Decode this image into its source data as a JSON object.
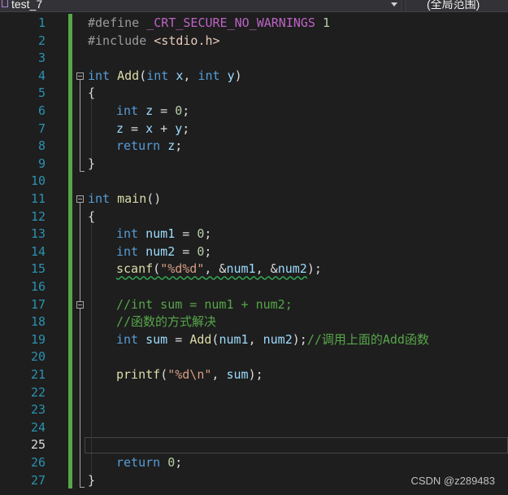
{
  "toolbar": {
    "file_name": "test_7",
    "file_icon": "project-icon",
    "scope_label": "(全局范围)"
  },
  "editor": {
    "current_line": 25,
    "line_numbers": [
      "1",
      "2",
      "3",
      "4",
      "5",
      "6",
      "7",
      "8",
      "9",
      "10",
      "11",
      "12",
      "13",
      "14",
      "15",
      "16",
      "17",
      "18",
      "19",
      "20",
      "21",
      "22",
      "23",
      "24",
      "25",
      "26",
      "27"
    ],
    "code": {
      "l1_define": "#define",
      "l1_macro": "_CRT_SECURE_NO_WARNINGS",
      "l1_value": "1",
      "l2_include": "#include",
      "l2_header": "<stdio.h>",
      "l4_int": "int",
      "l4_name": "Add",
      "l4_open": "(",
      "l4_int2": "int",
      "l4_x": "x",
      "l4_comma": ", ",
      "l4_int3": "int",
      "l4_y": "y",
      "l4_close": ")",
      "l5": "{",
      "l6_int": "int",
      "l6_z": "z",
      "l6_assign": " = ",
      "l6_zero": "0",
      "l6_semi": ";",
      "l7_z": "z",
      "l7_expr_a": " = ",
      "l7_x": "x",
      "l7_plus": " + ",
      "l7_y": "y",
      "l7_semi": ";",
      "l8_return": "return",
      "l8_z": "z",
      "l8_semi": ";",
      "l9": "}",
      "l11_int": "int",
      "l11_main": "main",
      "l11_paren": "()",
      "l12": "{",
      "l13_int": "int",
      "l13_num1": "num1",
      "l13_assign": " = ",
      "l13_zero": "0",
      "l13_semi": ";",
      "l14_int": "int",
      "l14_num2": "num2",
      "l14_assign": " = ",
      "l14_zero": "0",
      "l14_semi": ";",
      "l15_scanf": "scanf",
      "l15_open": "(",
      "l15_fmt": "\"%d%d\"",
      "l15_comma1": ", &",
      "l15_num1": "num1",
      "l15_comma2": ", &",
      "l15_num2": "num2",
      "l15_close": ");",
      "l17_comment": "//int sum = num1 + num2;",
      "l18_comment": "//函数的方式解决",
      "l19_int": "int",
      "l19_sum": "sum",
      "l19_assign": " = ",
      "l19_add": "Add",
      "l19_open": "(",
      "l19_num1": "num1",
      "l19_comma": ", ",
      "l19_num2": "num2",
      "l19_close": ");",
      "l19_comment": "//调用上面的Add函数",
      "l21_printf": "printf",
      "l21_open": "(",
      "l21_fmt": "\"%d\\n\"",
      "l21_comma": ", ",
      "l21_sum": "sum",
      "l21_close": ");",
      "l26_return": "return",
      "l26_zero": "0",
      "l26_semi": ";",
      "l27": "}"
    }
  },
  "watermark": "CSDN @z289483"
}
